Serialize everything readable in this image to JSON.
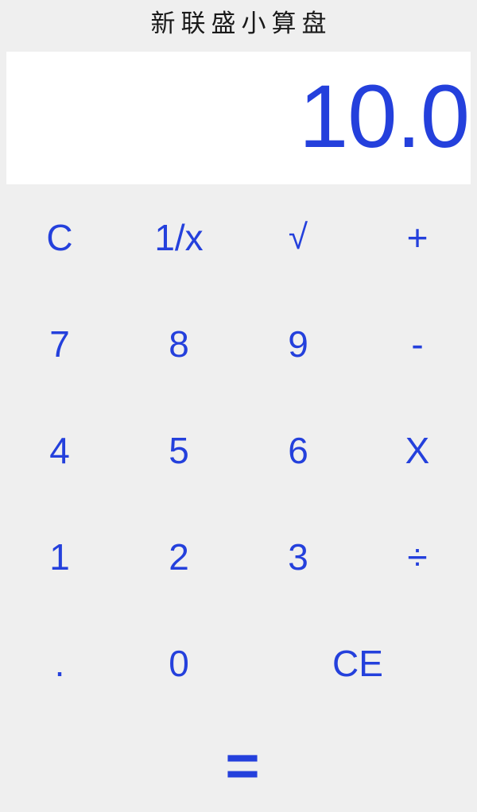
{
  "app": {
    "title": "新联盛小算盘",
    "background_color": "#efefef",
    "accent_color": "#2440dc",
    "display_background": "#ffffff",
    "title_color": "#1a1a1a"
  },
  "display": {
    "value": "10.0"
  },
  "keypad": {
    "rows": [
      [
        {
          "label": "C",
          "name": "key-clear"
        },
        {
          "label": "1/x",
          "name": "key-reciprocal"
        },
        {
          "label": "√",
          "name": "key-square-root"
        },
        {
          "label": "+",
          "name": "key-add"
        }
      ],
      [
        {
          "label": "7",
          "name": "key-7"
        },
        {
          "label": "8",
          "name": "key-8"
        },
        {
          "label": "9",
          "name": "key-9"
        },
        {
          "label": "-",
          "name": "key-subtract"
        }
      ],
      [
        {
          "label": "4",
          "name": "key-4"
        },
        {
          "label": "5",
          "name": "key-5"
        },
        {
          "label": "6",
          "name": "key-6"
        },
        {
          "label": "X",
          "name": "key-multiply"
        }
      ],
      [
        {
          "label": "1",
          "name": "key-1"
        },
        {
          "label": "2",
          "name": "key-2"
        },
        {
          "label": "3",
          "name": "key-3"
        },
        {
          "label": "÷",
          "name": "key-divide"
        }
      ],
      [
        {
          "label": ".",
          "name": "key-decimal"
        },
        {
          "label": "0",
          "name": "key-0"
        },
        {
          "label": "CE",
          "name": "key-clear-entry"
        }
      ]
    ],
    "equals_label": "="
  }
}
